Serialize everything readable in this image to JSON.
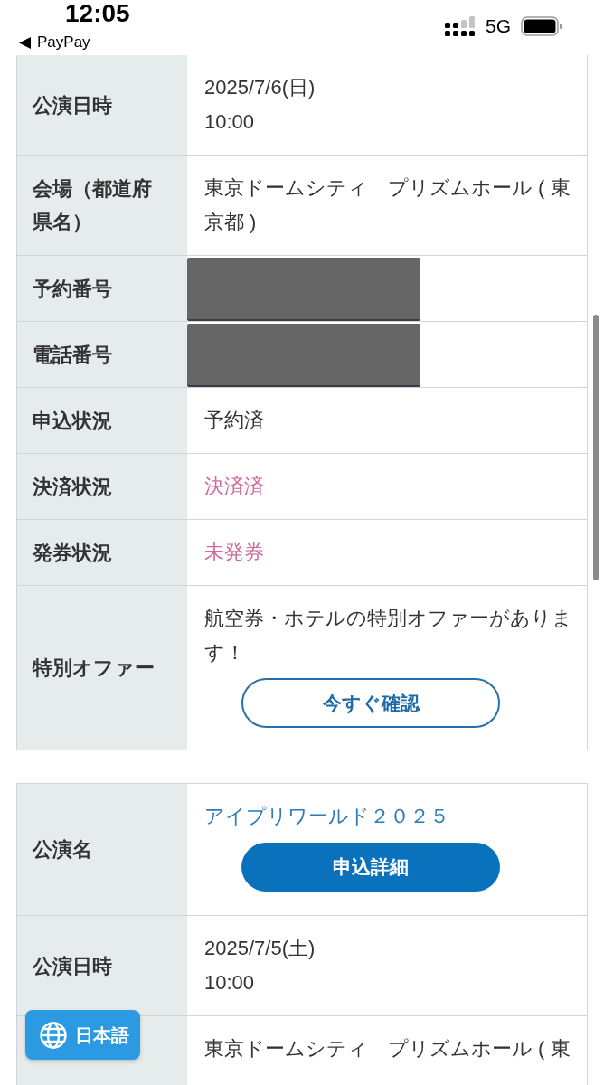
{
  "status_bar": {
    "time": "12:05",
    "back_app": "PayPay",
    "network": "5G"
  },
  "tables": [
    {
      "rows": [
        {
          "kind": "text",
          "label": "公演日時",
          "lines": [
            "2025/7/6(日)",
            "10:00"
          ],
          "color": "#333333"
        },
        {
          "kind": "text",
          "label": "会場（都道府県名）",
          "lines": [
            "東京ドームシティ　プリズムホール ( 東京都 )"
          ],
          "color": "#333333"
        },
        {
          "kind": "redacted",
          "label": "予約番号"
        },
        {
          "kind": "redacted",
          "label": "電話番号"
        },
        {
          "kind": "text",
          "label": "申込状況",
          "lines": [
            "予約済"
          ],
          "color": "#333333"
        },
        {
          "kind": "text",
          "label": "決済状況",
          "lines": [
            "決済済"
          ],
          "color": "#d0699e"
        },
        {
          "kind": "text",
          "label": "発券状況",
          "lines": [
            "未発券"
          ],
          "color": "#d0699e"
        },
        {
          "kind": "offer",
          "label": "特別オファー",
          "text": "航空券・ホテルの特別オファーがあります！",
          "button": "今すぐ確認"
        }
      ]
    },
    {
      "rows": [
        {
          "kind": "title",
          "label": "公演名",
          "title": "アイプリワールド２０２５",
          "button": "申込詳細"
        },
        {
          "kind": "text",
          "label": "公演日時",
          "lines": [
            "2025/7/5(土)",
            "10:00"
          ],
          "color": "#333333"
        },
        {
          "kind": "text",
          "lines": [
            "東京ドームシティ　プリズムホール ( 東"
          ],
          "color": "#333333"
        }
      ]
    }
  ],
  "language_button": {
    "label": "日本語"
  }
}
